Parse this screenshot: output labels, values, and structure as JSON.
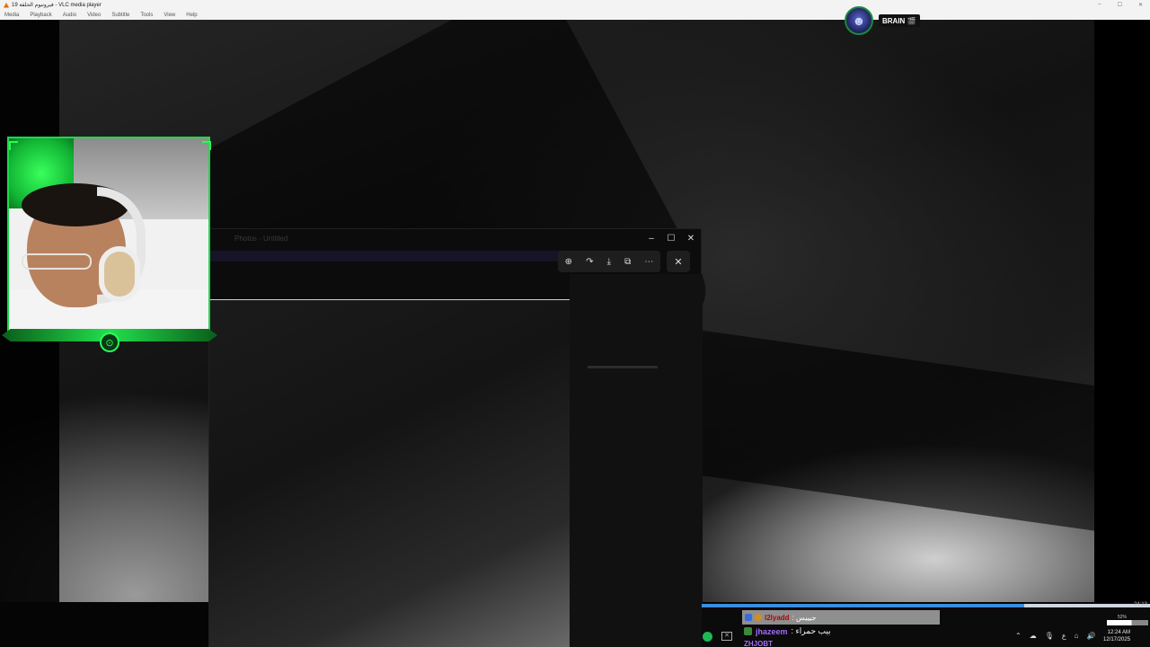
{
  "vlc": {
    "title": "19 فيروتيوم الحلقة - VLC media player",
    "menu": [
      "Media",
      "Playback",
      "Audio",
      "Video",
      "Subtitle",
      "Tools",
      "View",
      "Help"
    ]
  },
  "stream": {
    "badge_label": "BRAIN 🎬"
  },
  "viewer": {
    "title": "Photos - Untitled",
    "toolbar_icons": [
      "zoom-in-icon",
      "rotate-icon",
      "download-icon",
      "open-external-icon",
      "more-icon"
    ],
    "close_glyph": "✕",
    "min_glyph": "–",
    "max_glyph": "☐",
    "winclose_glyph": "✕"
  },
  "progress": {
    "fraction": 0.72,
    "time": "24:13"
  },
  "chat": {
    "line1_user": "l2lyadd",
    "line1_msg": ": جيييس",
    "line2_user": "jhazeem",
    "line2_msg": ": بيب حمراء",
    "line3_user": "ZHJOBT"
  },
  "tray": {
    "clock_time": "12:24 AM",
    "clock_date": "12/17/2025",
    "lang": "ع",
    "volume_label": "52%"
  },
  "colors": {
    "accent_green": "#1fd84a",
    "progress_blue": "#3b8dde"
  }
}
